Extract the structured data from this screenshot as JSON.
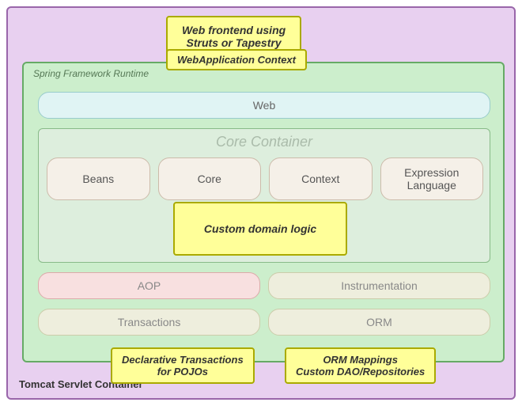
{
  "outer": {
    "tomcat_label": "Tomcat Servlet Container"
  },
  "web_frontend": {
    "line1": "Web frontend  using",
    "line2": "Struts or Tapestry"
  },
  "spring": {
    "label": "Spring Framework Runtime"
  },
  "webapp_context": {
    "label": "WebApplication Context"
  },
  "web_bar": {
    "label": "Web"
  },
  "core_container": {
    "label": "Core Container",
    "items": [
      {
        "label": "Beans"
      },
      {
        "label": "Core"
      },
      {
        "label": "Context"
      },
      {
        "label": "Expression\nLanguage"
      }
    ]
  },
  "custom_domain": {
    "label": "Custom domain logic"
  },
  "aop": {
    "label": "AOP"
  },
  "instrumentation": {
    "label": "Instrumentation"
  },
  "transactions": {
    "label": "Transactions"
  },
  "orm": {
    "label": "ORM"
  },
  "declarative": {
    "line1": "Declarative Transactions",
    "line2": "for POJOs"
  },
  "orm_mappings": {
    "line1": "ORM Mappings",
    "line2": "Custom DAO/Repositories"
  }
}
